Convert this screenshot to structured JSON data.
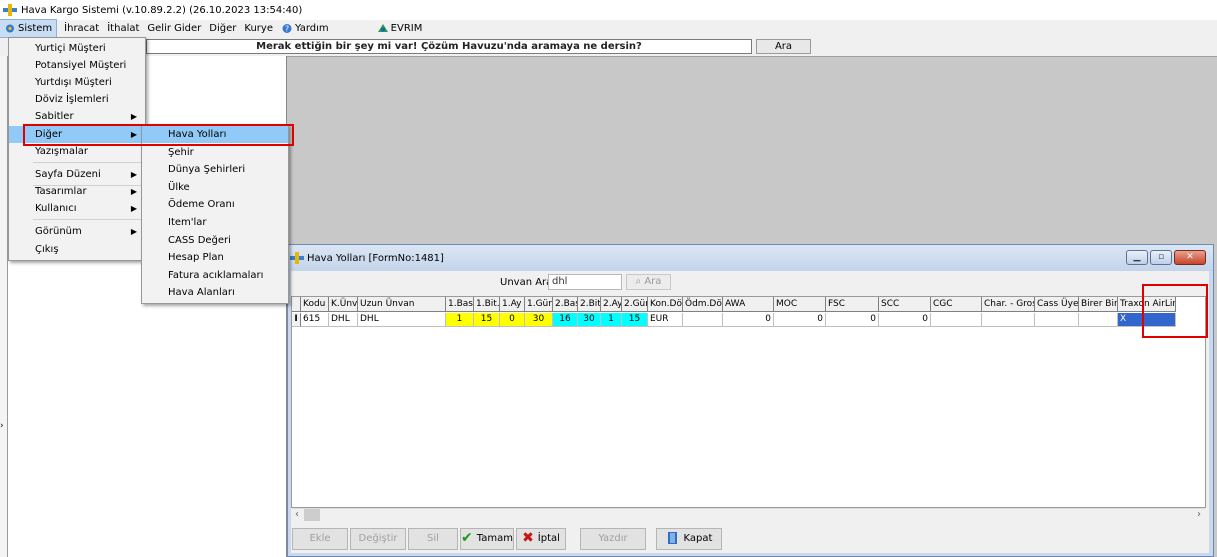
{
  "window": {
    "title": "Hava Kargo Sistemi (v.10.89.2.2) (26.10.2023 13:54:40)"
  },
  "menubar": {
    "items": [
      {
        "label": "Sistem"
      },
      {
        "label": "İhracat"
      },
      {
        "label": "İthalat"
      },
      {
        "label": "Gelir Gider"
      },
      {
        "label": "Diğer"
      },
      {
        "label": "Kurye"
      },
      {
        "label": "Yardım"
      },
      {
        "label": "EVRIM"
      }
    ]
  },
  "search": {
    "text": "Merak ettiğin bir şey mi var! Çözüm Havuzu'nda aramaya ne dersin?",
    "button": "Ara"
  },
  "sistem_menu": {
    "items": [
      {
        "label": "Yurtiçi Müşteri"
      },
      {
        "label": "Potansiyel Müşteri"
      },
      {
        "label": "Yurtdışı Müşteri"
      },
      {
        "label": "Döviz İşlemleri"
      },
      {
        "label": "Sabitler"
      },
      {
        "label": "Diğer"
      },
      {
        "label": "Yazışmalar"
      },
      {
        "label": "Sayfa Düzeni"
      },
      {
        "label": "Tasarımlar"
      },
      {
        "label": "Kullanıcı"
      },
      {
        "label": "Görünüm"
      },
      {
        "label": "Çıkış"
      }
    ]
  },
  "diger_submenu": {
    "items": [
      {
        "label": "Hava Yolları"
      },
      {
        "label": "Şehir"
      },
      {
        "label": "Dünya Şehirleri"
      },
      {
        "label": "Ülke"
      },
      {
        "label": "Ödeme Oranı"
      },
      {
        "label": "Item'lar"
      },
      {
        "label": "CASS Değeri"
      },
      {
        "label": "Hesap Plan"
      },
      {
        "label": "Fatura acıklamaları"
      },
      {
        "label": "Hava Alanları"
      }
    ]
  },
  "child_window": {
    "title": "Hava Yolları [FormNo:1481]",
    "search_label": "Unvan Ara",
    "search_value": "dhl",
    "search_button": "Ara"
  },
  "grid": {
    "row_indicator": "I",
    "headers": [
      "Kodu",
      "K.Ünv.",
      "Uzun Ünvan",
      "1.Bas.",
      "1.Bit.",
      "1.Ay",
      "1.Gün",
      "2.Bas",
      "2.Bit",
      "2.Ay",
      "2.Gün",
      "Kon.Döv.",
      "Ödm.Döv.",
      "AWA",
      "MOC",
      "FSC",
      "SCC",
      "CGC",
      "Char. - Gross",
      "Cass Üyesi",
      "Birer Birer",
      "Traxon AirLines"
    ],
    "rows": [
      [
        "615",
        "DHL",
        "DHL",
        "1",
        "15",
        "0",
        "30",
        "16",
        "30",
        "1",
        "15",
        "EUR",
        "",
        "0",
        "0",
        "0",
        "0",
        "",
        "",
        "",
        "",
        "X"
      ]
    ]
  },
  "buttons": {
    "ekle": "Ekle",
    "degistir": "Değiştir",
    "sil": "Sil",
    "tamam": "Tamam",
    "iptal": "İptal",
    "yazdir": "Yazdır",
    "kapat": "Kapat"
  },
  "colors": {
    "highlight": "#91c9f7",
    "annotation_red": "#e00000",
    "cell_yellow": "#ffff00",
    "cell_cyan": "#00ffff"
  }
}
